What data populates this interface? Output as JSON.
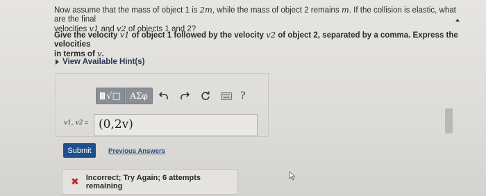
{
  "question": {
    "line1_pre": "Now assume that the mass of object 1 is ",
    "mass1": "2m",
    "line1_mid": ", while the mass of object 2 remains ",
    "mass2": "m",
    "line1_post": ". If the collision is elastic, what are the final",
    "line2_pre": "velocities ",
    "v1": "v1",
    "and": " and ",
    "v2": "v2",
    "line2_post": " of objects 1 and 2?"
  },
  "instruction": {
    "pre": "Give the velocity ",
    "v1": "v1",
    "mid": " of object 1 followed by the velocity ",
    "v2": "v2",
    "post": " of object 2, separated by a comma. Express the velocities",
    "line2_pre": "in terms of ",
    "v": "v",
    "line2_post": "."
  },
  "hints_label": "View Available Hint(s)",
  "toolbar": {
    "templates_label": "√□",
    "symbols_label": "ΑΣφ",
    "help_label": "?"
  },
  "answer": {
    "label_vars": "v1, v2",
    "label_eq": " =",
    "value": "(0,2v)"
  },
  "submit_label": "Submit",
  "previous_answers_label": "Previous Answers",
  "feedback": {
    "icon": "✖",
    "text": "Incorrect; Try Again; 6 attempts remaining",
    "color": "#c0282a"
  }
}
